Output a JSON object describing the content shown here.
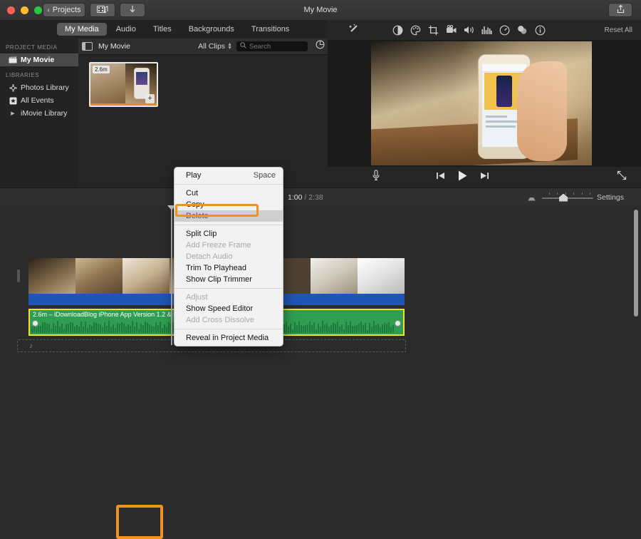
{
  "window": {
    "title": "My Movie",
    "projects_button": "Projects",
    "media_button_icon": "film-music-icon",
    "import_button_icon": "download-arrow-icon",
    "share_button_icon": "share-icon"
  },
  "tabs": [
    {
      "label": "My Media",
      "active": true
    },
    {
      "label": "Audio",
      "active": false
    },
    {
      "label": "Titles",
      "active": false
    },
    {
      "label": "Backgrounds",
      "active": false
    },
    {
      "label": "Transitions",
      "active": false
    }
  ],
  "sidebar": {
    "sections": [
      {
        "title": "Project Media",
        "items": [
          {
            "label": "My Movie",
            "icon": "clapperboard-icon",
            "selected": true
          }
        ]
      },
      {
        "title": "Libraries",
        "items": [
          {
            "label": "Photos Library",
            "icon": "photos-icon",
            "selected": false
          },
          {
            "label": "All Events",
            "icon": "star-icon",
            "selected": false
          },
          {
            "label": "iMovie Library",
            "icon": "disclosure-triangle-icon",
            "selected": false
          }
        ]
      }
    ]
  },
  "browser": {
    "panel_toggle_icon": "sidebar-toggle-icon",
    "title": "My Movie",
    "filter": "All Clips",
    "search_placeholder": "Search",
    "settings_icon": "gear-icon",
    "clip": {
      "duration": "2.6m",
      "add_icon": "plus-icon"
    }
  },
  "preview": {
    "enhance_icon": "magic-wand-icon",
    "adjust_icons": [
      "color-balance-icon",
      "color-correction-icon",
      "crop-icon",
      "stabilization-icon",
      "volume-icon",
      "equalizer-icon",
      "speed-icon",
      "filters-icon",
      "info-icon"
    ],
    "reset_label": "Reset All",
    "transport": {
      "voiceover_icon": "microphone-icon",
      "previous_icon": "skip-previous-icon",
      "play_icon": "play-icon",
      "next_icon": "skip-next-icon",
      "fullscreen_icon": "expand-arrows-icon"
    }
  },
  "timeline_toolbar": {
    "current_time": "1:00",
    "separator": "/",
    "total_time": "2:38",
    "zoom_min_icon": "zoom-out-icon",
    "zoom_max_icon": "zoom-in-icon",
    "settings_label": "Settings"
  },
  "timeline": {
    "audio_clip_label": "2.6m – iDownloadBlog iPhone App Version 1.2 & New F",
    "dropzone_icon": "music-note-icon"
  },
  "context_menu": {
    "items": [
      {
        "label": "Play",
        "shortcut": "Space",
        "state": "normal"
      },
      {
        "separator": true
      },
      {
        "label": "Cut",
        "shortcut": "",
        "state": "normal"
      },
      {
        "label": "Copy",
        "shortcut": "",
        "state": "normal"
      },
      {
        "label": "Delete",
        "shortcut": "",
        "state": "highlight"
      },
      {
        "separator": true
      },
      {
        "label": "Split Clip",
        "shortcut": "",
        "state": "normal"
      },
      {
        "label": "Add Freeze Frame",
        "shortcut": "",
        "state": "disabled"
      },
      {
        "label": "Detach Audio",
        "shortcut": "",
        "state": "disabled"
      },
      {
        "label": "Trim To Playhead",
        "shortcut": "",
        "state": "normal"
      },
      {
        "label": "Show Clip Trimmer",
        "shortcut": "",
        "state": "normal"
      },
      {
        "separator": true
      },
      {
        "label": "Adjust",
        "shortcut": "",
        "state": "disabled"
      },
      {
        "label": "Show Speed Editor",
        "shortcut": "",
        "state": "normal"
      },
      {
        "label": "Add Cross Dissolve",
        "shortcut": "",
        "state": "disabled"
      },
      {
        "separator": true
      },
      {
        "label": "Reveal in Project Media",
        "shortcut": "",
        "state": "normal"
      }
    ]
  },
  "colors": {
    "annotation": "#f2911b",
    "audio_clip": "#2f9e52",
    "audio_selection": "#f0e52a",
    "video_bar": "#1f55b5"
  }
}
